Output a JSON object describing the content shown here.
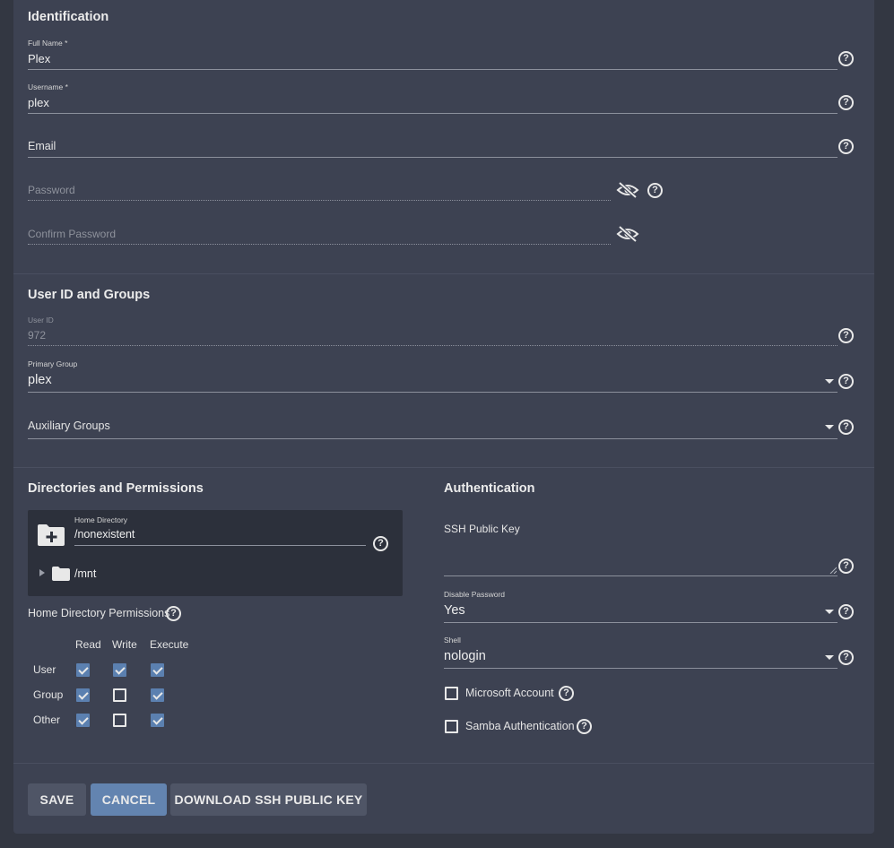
{
  "identification": {
    "title": "Identification",
    "full_name_label": "Full Name *",
    "full_name_value": "Plex",
    "username_label": "Username *",
    "username_value": "plex",
    "email_placeholder": "Email",
    "password_placeholder": "Password",
    "confirm_password_placeholder": "Confirm Password"
  },
  "user_groups": {
    "title": "User ID and Groups",
    "user_id_label": "User ID",
    "user_id_value": "972",
    "primary_group_label": "Primary Group",
    "primary_group_value": "plex",
    "aux_groups_placeholder": "Auxiliary Groups"
  },
  "directories": {
    "title": "Directories and Permissions",
    "home_dir_label": "Home Directory",
    "home_dir_value": "/nonexistent",
    "tree_item": "/mnt",
    "permissions_label": "Home Directory Permissions",
    "columns": [
      "Read",
      "Write",
      "Execute"
    ],
    "rows": [
      {
        "name": "User",
        "read": true,
        "write": true,
        "execute": true
      },
      {
        "name": "Group",
        "read": true,
        "write": false,
        "execute": true
      },
      {
        "name": "Other",
        "read": true,
        "write": false,
        "execute": true
      }
    ]
  },
  "authentication": {
    "title": "Authentication",
    "ssh_key_label": "SSH Public Key",
    "disable_password_label": "Disable Password",
    "disable_password_value": "Yes",
    "shell_label": "Shell",
    "shell_value": "nologin",
    "microsoft_account_label": "Microsoft Account",
    "microsoft_account_checked": false,
    "samba_auth_label": "Samba Authentication",
    "samba_auth_checked": false
  },
  "actions": {
    "save": "SAVE",
    "cancel": "CANCEL",
    "download_key": "DOWNLOAD SSH PUBLIC KEY"
  },
  "colors": {
    "page_bg": "#333742",
    "card_bg": "#3d4252",
    "accent": "#6384b0",
    "checkbox_checked": "#5b80b0"
  }
}
